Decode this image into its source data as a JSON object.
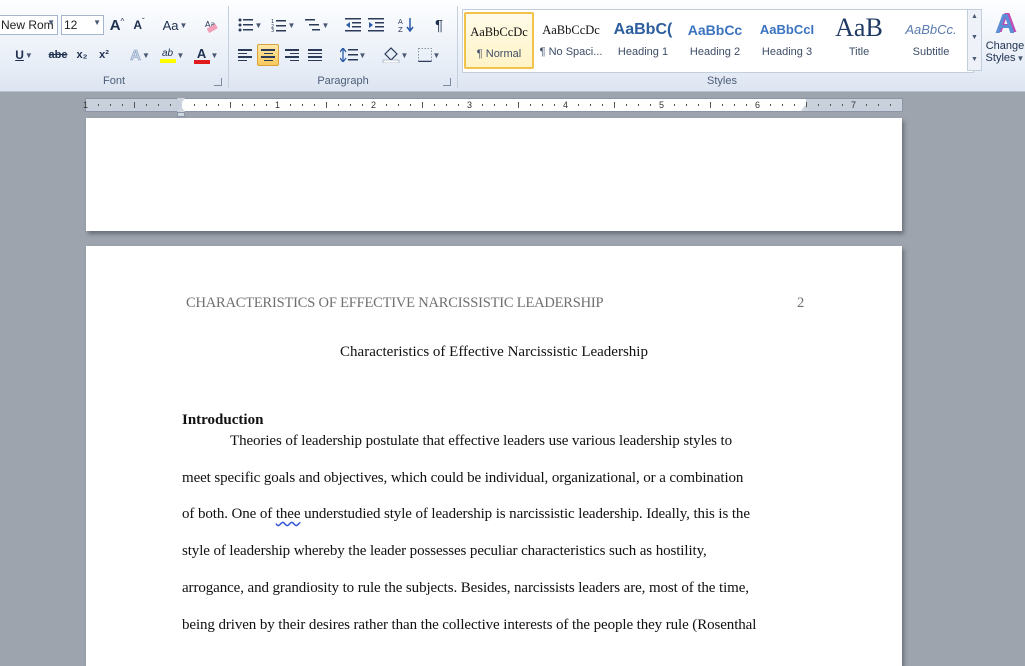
{
  "ribbon": {
    "font_group": {
      "label": "Font",
      "font_name": "New Rom",
      "font_size": "12",
      "grow_font": "A",
      "shrink_font": "A",
      "change_case": "Aa",
      "underline": "U",
      "strikethrough": "abe",
      "subscript": "x₂",
      "superscript": "x²",
      "text_effects": "A",
      "highlight": "ab",
      "font_color": "A"
    },
    "paragraph_group": {
      "label": "Paragraph",
      "show_marks": "¶"
    },
    "styles_group": {
      "label": "Styles",
      "items": [
        {
          "sample": "AaBbCcDc",
          "name": "¶ Normal"
        },
        {
          "sample": "AaBbCcDc",
          "name": "¶ No Spaci..."
        },
        {
          "sample": "AaBbC(",
          "name": "Heading 1"
        },
        {
          "sample": "AaBbCc",
          "name": "Heading 2"
        },
        {
          "sample": "AaBbCcI",
          "name": "Heading 3"
        },
        {
          "sample": "AaB",
          "name": "Title"
        },
        {
          "sample": "AaBbCc.",
          "name": "Subtitle"
        }
      ],
      "change_styles_line1": "Change",
      "change_styles_line2": "Styles",
      "change_styles_icon": "A"
    }
  },
  "ruler": {
    "numbers": [
      "1",
      "1",
      "2",
      "3",
      "4",
      "5",
      "6",
      "7"
    ]
  },
  "document": {
    "running_head": "CHARACTERISTICS OF EFFECTIVE NARCISSISTIC LEADERSHIP",
    "page_number": "2",
    "title": "Characteristics of Effective Narcissistic Leadership",
    "heading": "Introduction",
    "lines": [
      "Theories of leadership postulate that effective leaders use various leadership styles to",
      "meet specific goals and objectives, which could be individual, organizational, or a combination",
      "of both. One of",
      "thee",
      "understudied style of leadership is narcissistic leadership. Ideally, this is the",
      "style of leadership whereby the leader possesses peculiar characteristics such as hostility,",
      "arrogance, and grandiosity to rule the subjects. Besides, narcissists leaders are, most of the time,",
      "being driven by their desires rather than the collective interests of the people they rule (Rosenthal"
    ]
  },
  "colors": {
    "workspace": "#9ea4ad",
    "ribbon_accent": "#4c5d78",
    "heading_blue": "#2d5e9e",
    "selected_style_border": "#f2c24b"
  }
}
